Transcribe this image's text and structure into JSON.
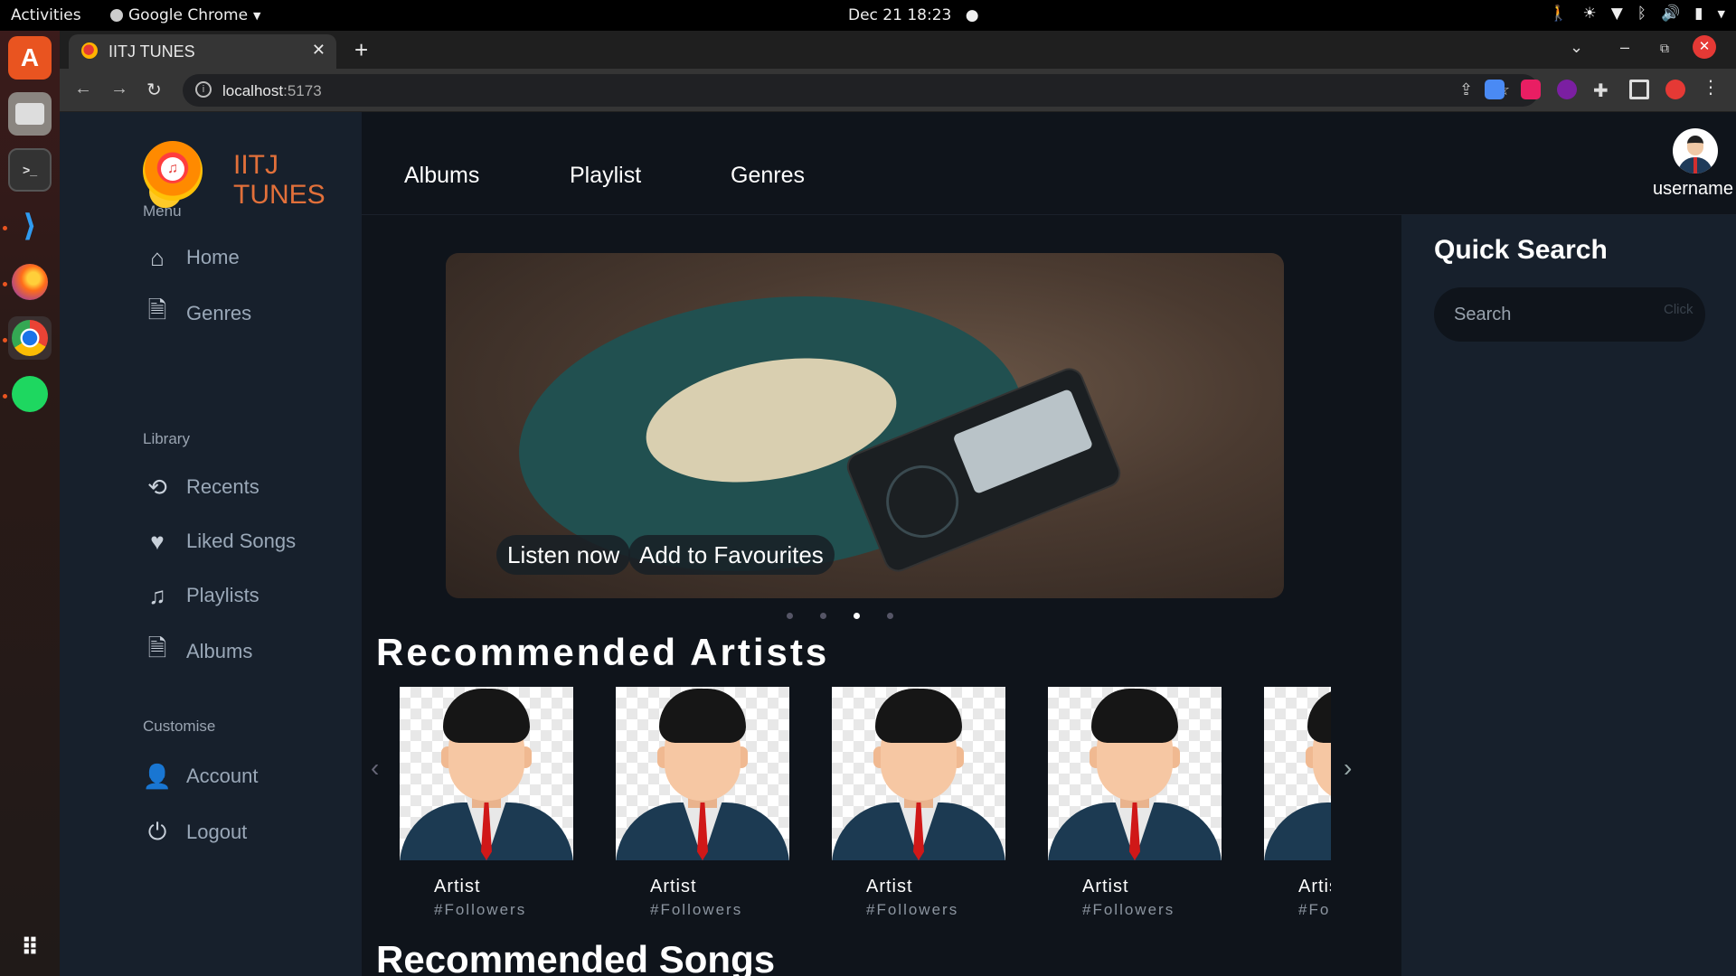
{
  "os": {
    "activities": "Activities",
    "app_name": "Google Chrome",
    "clock": "Dec 21  18:23"
  },
  "browser": {
    "tab_title": "IITJ TUNES",
    "url_host": "localhost",
    "url_port": ":5173"
  },
  "app": {
    "brand_line1": "IITJ",
    "brand_line2": "TUNES",
    "menu_title": "Menu",
    "menu_items": [
      {
        "label": "Home",
        "icon": "home-icon"
      },
      {
        "label": "Genres",
        "icon": "document-icon"
      }
    ],
    "library_title": "Library",
    "library_items": [
      {
        "label": "Recents",
        "icon": "history-icon"
      },
      {
        "label": "Liked Songs",
        "icon": "heart-icon"
      },
      {
        "label": "Playlists",
        "icon": "music-note-icon"
      },
      {
        "label": "Albums",
        "icon": "document-icon"
      }
    ],
    "customise_title": "Customise",
    "customise_items": [
      {
        "label": "Account",
        "icon": "user-icon"
      },
      {
        "label": "Logout",
        "icon": "power-icon"
      }
    ],
    "top_nav": [
      "Albums",
      "Playlist",
      "Genres"
    ],
    "username": "username",
    "hero": {
      "listen_label": "Listen now",
      "fav_label": "Add to Favourites",
      "slide_count": 4,
      "active_slide": 3
    },
    "recommended_artists_title": "Recommended Artists",
    "artists": [
      {
        "name": "Artist",
        "followers": "#Followers"
      },
      {
        "name": "Artist",
        "followers": "#Followers"
      },
      {
        "name": "Artist",
        "followers": "#Followers"
      },
      {
        "name": "Artist",
        "followers": "#Followers"
      },
      {
        "name": "Artist",
        "followers": "#Followers"
      }
    ],
    "recommended_songs_title": "Recommended Songs",
    "quick_search_title": "Quick Search",
    "search_placeholder": "Search",
    "search_button": "Click"
  },
  "colors": {
    "brand": "#e2703a",
    "sidebar_bg": "#17202c",
    "main_bg": "#0f141b"
  }
}
